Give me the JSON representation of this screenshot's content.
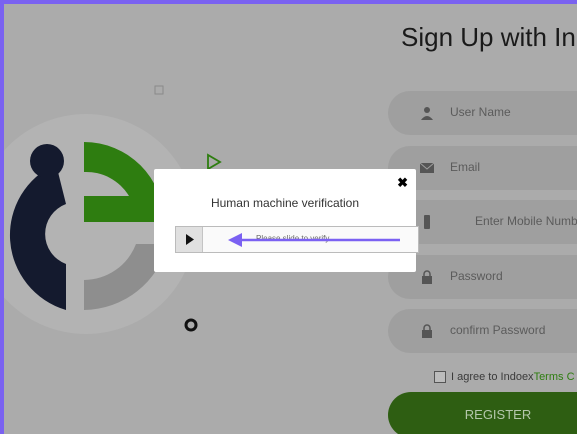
{
  "form": {
    "title": "Sign Up with In",
    "fields": [
      {
        "placeholder": "User Name",
        "icon": "user-icon"
      },
      {
        "placeholder": "Email",
        "icon": "envelope-icon"
      },
      {
        "placeholder": "Enter Mobile Number",
        "icon": "phone-icon"
      },
      {
        "placeholder": "Password",
        "icon": "lock-icon"
      },
      {
        "placeholder": "confirm Password",
        "icon": "lock-icon"
      }
    ],
    "agree_text": "I agree to Indoex",
    "terms_link": "Terms C",
    "register_label": "REGISTER"
  },
  "modal": {
    "title": "Human machine verification",
    "close_label": "✖",
    "slider_hint": "Please slide to verify"
  },
  "colors": {
    "frame": "#7a62f0",
    "brand_green": "#2e7d10",
    "logo_dark": "#141a2e",
    "arrow": "#7b61f2"
  }
}
